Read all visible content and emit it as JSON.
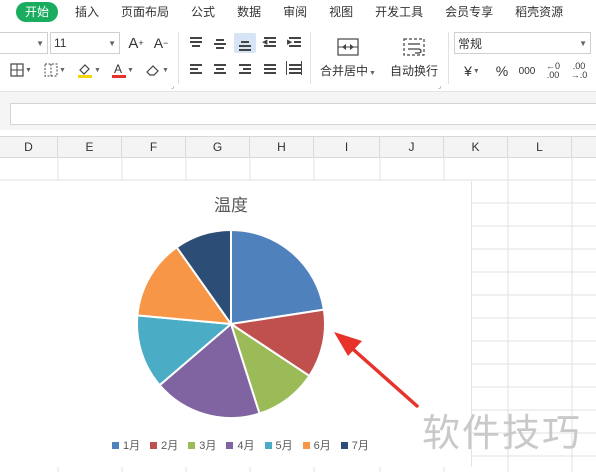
{
  "tabs": [
    {
      "label": "开始",
      "active": true
    },
    {
      "label": "插入",
      "active": false
    },
    {
      "label": "页面布局",
      "active": false
    },
    {
      "label": "公式",
      "active": false
    },
    {
      "label": "数据",
      "active": false
    },
    {
      "label": "审阅",
      "active": false
    },
    {
      "label": "视图",
      "active": false
    },
    {
      "label": "开发工具",
      "active": false
    },
    {
      "label": "会员专享",
      "active": false
    },
    {
      "label": "稻壳资源",
      "active": false
    }
  ],
  "toolbar": {
    "font_size": "11",
    "font_grow": "A⁺",
    "font_shrink": "A⁻",
    "merge_center": "合并居中",
    "auto_wrap": "自动换行",
    "number_format": "常规",
    "currency": "¥",
    "percent": "%",
    "thousands": "000",
    "inc_decimal": "←0\n.00",
    "dec_decimal": ".00\n→.0"
  },
  "columns": [
    "D",
    "E",
    "F",
    "G",
    "H",
    "I",
    "J",
    "K",
    "L"
  ],
  "colors": {
    "accent": "#1aad5f",
    "arrow": "#e8322c"
  },
  "watermark": "软件技巧",
  "chart_data": {
    "type": "pie",
    "title": "温度",
    "categories": [
      "1月",
      "2月",
      "3月",
      "4月",
      "5月",
      "6月",
      "7月"
    ],
    "values": [
      23,
      12,
      11,
      19,
      13,
      14,
      10
    ],
    "colors": [
      "#4f81bd",
      "#c0504d",
      "#9bbb59",
      "#8064a2",
      "#4bacc6",
      "#f79646",
      "#2c4d75"
    ],
    "start_angle_deg": 0,
    "direction": "clockwise",
    "legend_position": "bottom"
  }
}
